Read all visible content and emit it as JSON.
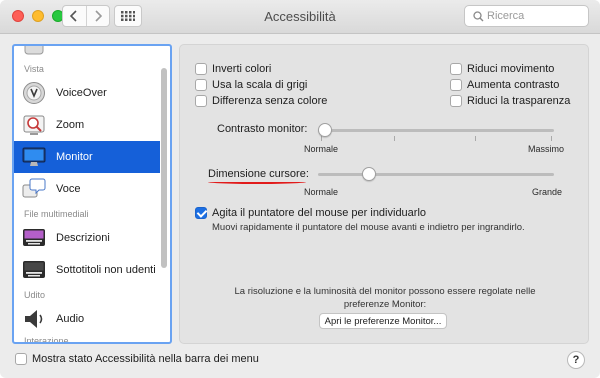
{
  "window": {
    "title": "Accessibilità"
  },
  "search": {
    "placeholder": "Ricerca"
  },
  "sidebar": {
    "groups": [
      {
        "label": "Vista"
      },
      {
        "label": "File multimediali"
      },
      {
        "label": "Udito"
      },
      {
        "label": "Interazione"
      }
    ],
    "items": [
      {
        "label": "VoiceOver",
        "icon": "voiceover-icon"
      },
      {
        "label": "Zoom",
        "icon": "zoom-icon"
      },
      {
        "label": "Monitor",
        "icon": "monitor-icon",
        "selected": true
      },
      {
        "label": "Voce",
        "icon": "speech-icon"
      },
      {
        "label": "Descrizioni",
        "icon": "descriptions-icon"
      },
      {
        "label": "Sottotitoli non udenti",
        "icon": "captions-icon"
      },
      {
        "label": "Audio",
        "icon": "audio-icon"
      }
    ]
  },
  "options": {
    "left": [
      {
        "label": "Inverti colori",
        "checked": false
      },
      {
        "label": "Usa la scala di grigi",
        "checked": false
      },
      {
        "label": "Differenza senza colore",
        "checked": false
      }
    ],
    "right": [
      {
        "label": "Riduci movimento",
        "checked": false
      },
      {
        "label": "Aumenta contrasto",
        "checked": false
      },
      {
        "label": "Riduci la trasparenza",
        "checked": false
      }
    ]
  },
  "contrast": {
    "label": "Contrasto monitor:",
    "min_label": "Normale",
    "max_label": "Massimo",
    "value": 0.0
  },
  "cursor": {
    "label": "Dimensione cursore:",
    "min_label": "Normale",
    "max_label": "Grande",
    "value": 0.2
  },
  "shake": {
    "label": "Agita il puntatore del mouse per individuarlo",
    "checked": true,
    "description": "Muovi rapidamente il puntatore del mouse avanti e indietro per ingrandirlo."
  },
  "note": {
    "line1": "La risoluzione e la luminosità del monitor possono essere regolate nelle",
    "line2": "preferenze Monitor:"
  },
  "open_monitor_button": "Apri le preferenze Monitor...",
  "menubar_status": {
    "label": "Mostra stato Accessibilità nella barra dei menu",
    "checked": false
  },
  "help": "?",
  "colors": {
    "accent": "#1560d9",
    "annotation_underline": "#e11b1b",
    "focus_ring": "#6aa3f2"
  }
}
